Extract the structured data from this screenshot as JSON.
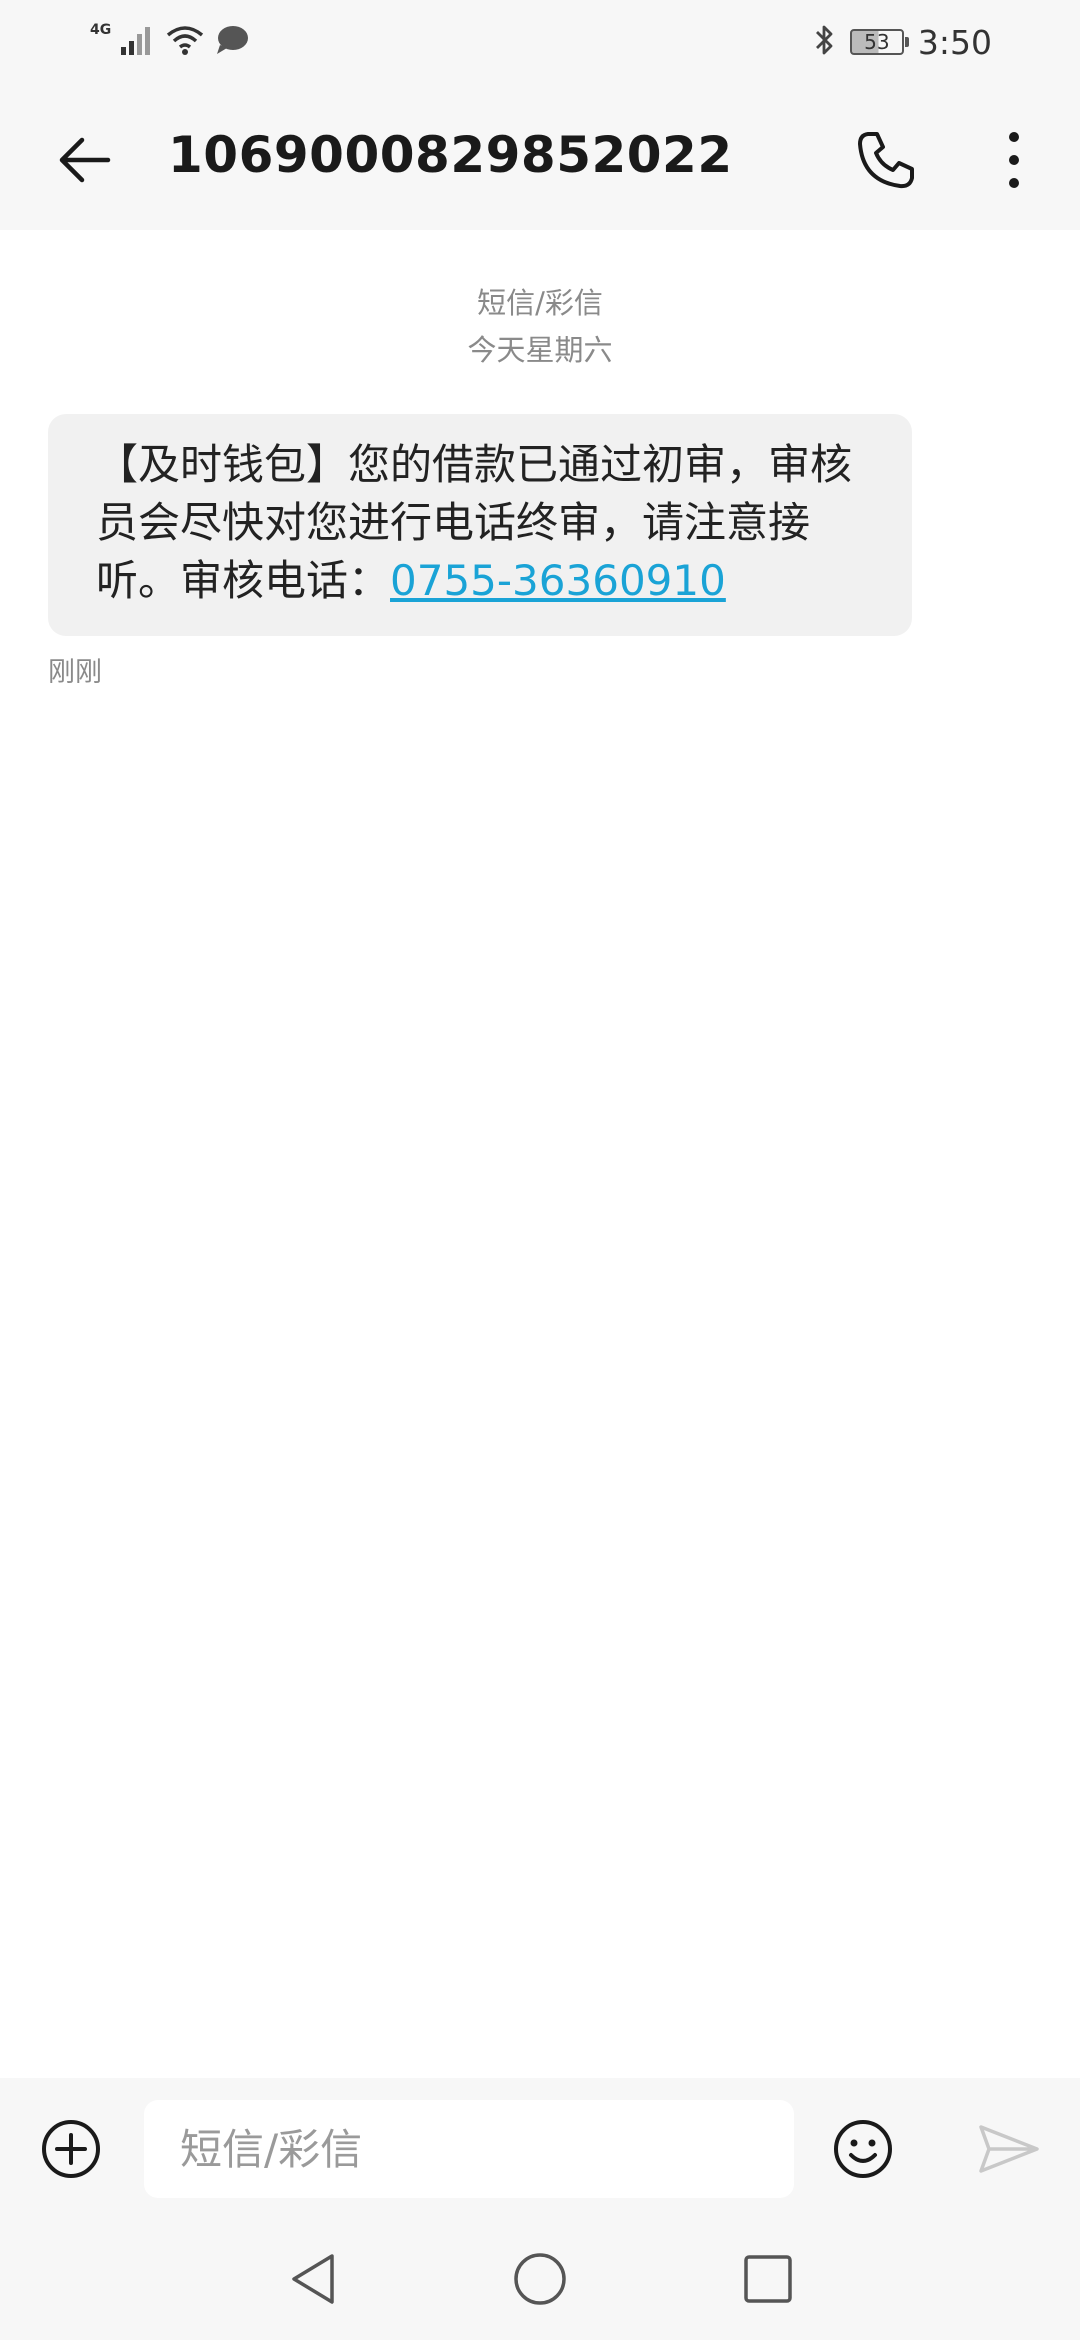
{
  "status_bar": {
    "network_type": "4G",
    "battery_level": "53",
    "battery_fraction": 0.53,
    "time": "3:50",
    "icons": [
      "signal-icon",
      "wifi-icon",
      "message-notification-icon",
      "bluetooth-icon",
      "battery-icon"
    ]
  },
  "header": {
    "contact_number": "1069000829852022",
    "icons": [
      "back-arrow-icon",
      "phone-icon",
      "more-vertical-icon"
    ]
  },
  "thread": {
    "type_label": "短信/彩信",
    "date_label": "今天星期六",
    "messages": [
      {
        "text": "【及时钱包】您的借款已通过初审，审核员会尽快对您进行电话终审，请注意接听。审核电话：",
        "link": "0755-36360910",
        "time": "刚刚"
      }
    ]
  },
  "composer": {
    "placeholder": "短信/彩信",
    "icons": [
      "add-circle-icon",
      "emoji-icon",
      "send-icon"
    ]
  },
  "navigation": {
    "icons": [
      "nav-back-icon",
      "nav-home-icon",
      "nav-recents-icon"
    ]
  },
  "colors": {
    "bar_background": "#f7f7f7",
    "bubble_background": "#f1f1f1",
    "link": "#1aa3d6",
    "meta_text": "#8a8a8a"
  }
}
